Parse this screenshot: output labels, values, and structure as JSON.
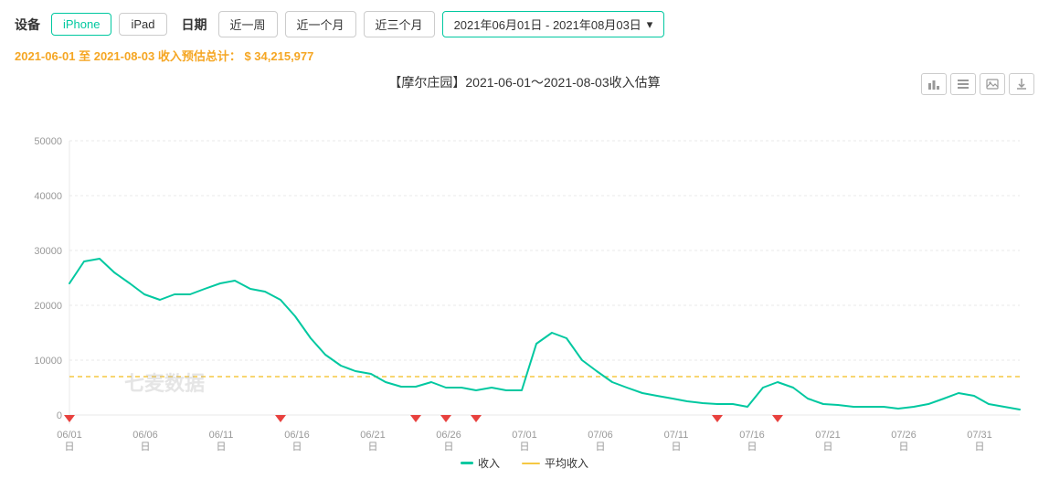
{
  "header": {
    "device_label": "设备",
    "date_label": "日期",
    "iphone_label": "iPhone",
    "ipad_label": "iPad",
    "week_label": "近一周",
    "month_label": "近一个月",
    "three_months_label": "近三个月",
    "date_range": "2021年06月01日 - 2021年08月03日"
  },
  "summary": {
    "text_prefix": "2021-06-01 至 2021-08-03 收入预估总计：",
    "amount": "$ 34,215,977"
  },
  "chart": {
    "title": "【摩尔庄园】2021-06-01～2021-08-03收入估算",
    "y_labels": [
      "50000",
      "40000",
      "30000",
      "20000",
      "10000",
      "0"
    ],
    "x_labels": [
      "06/01",
      "06/06",
      "06/11",
      "06/16",
      "06/21",
      "06/26",
      "07/01",
      "07/06",
      "07/11",
      "07/16",
      "07/21",
      "07/26",
      "07/31"
    ],
    "watermark": "七麦数据",
    "colors": {
      "line": "#00c8a0",
      "avg": "#f5c842",
      "flag": "#e8413e"
    }
  },
  "legend": {
    "revenue_label": "收入",
    "avg_label": "平均收入"
  },
  "toolbar": {
    "bar_chart_icon": "bar",
    "list_icon": "list",
    "image_icon": "img",
    "download_icon": "dl"
  }
}
